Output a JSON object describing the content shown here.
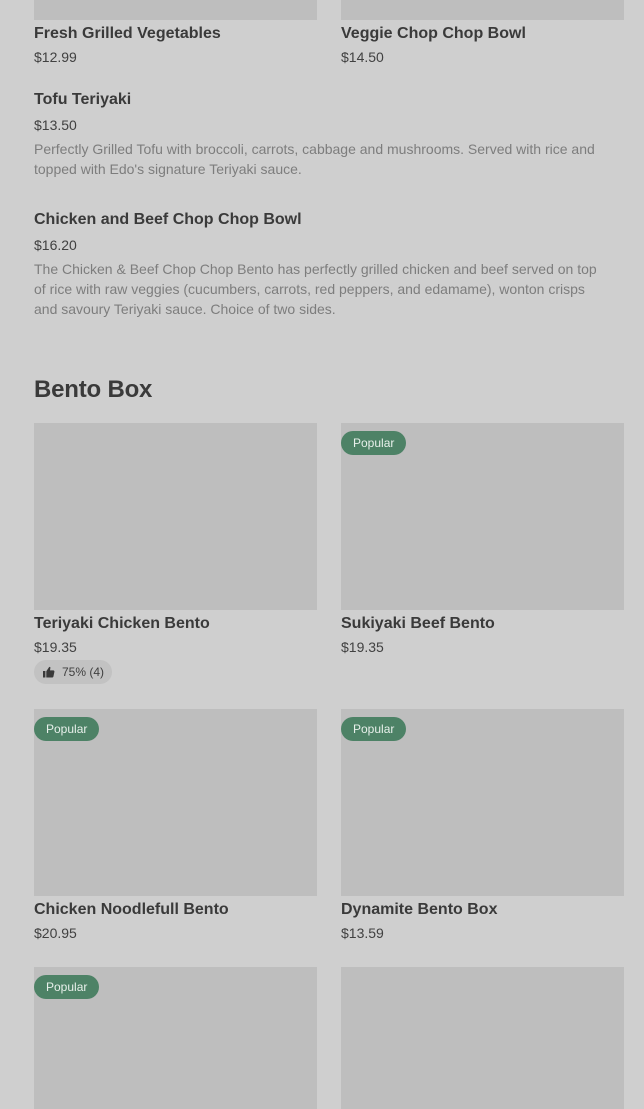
{
  "top_row": [
    {
      "title": "Fresh Grilled Vegetables",
      "price": "$12.99"
    },
    {
      "title": "Veggie Chop Chop Bowl",
      "price": "$14.50"
    }
  ],
  "list_items": [
    {
      "title": "Tofu Teriyaki",
      "price": "$13.50",
      "desc_lines": [
        "Perfectly Grilled Tofu with broccoli, carrots, cabbage and mushrooms. Served with rice and",
        "topped with Edo's signature Teriyaki sauce."
      ]
    },
    {
      "title": "Chicken and Beef Chop Chop Bowl",
      "price": "$16.20",
      "desc_lines": [
        "The Chicken & Beef Chop Chop Bento has perfectly grilled chicken and beef served on top",
        "of rice with raw veggies (cucumbers, carrots, red peppers, and edamame), wonton crisps",
        "and savoury Teriyaki sauce. Choice of two sides."
      ]
    }
  ],
  "section": {
    "title": "Bento Box"
  },
  "cards": [
    {
      "title": "Teriyaki Chicken Bento",
      "price": "$19.35",
      "badge": "",
      "rating": "75% (4)"
    },
    {
      "title": "Sukiyaki Beef Bento",
      "price": "$19.35",
      "badge": "Popular"
    },
    {
      "title": "Chicken Noodlefull Bento",
      "price": "$20.95",
      "badge": "Popular"
    },
    {
      "title": "Dynamite Bento Box",
      "price": "$13.59",
      "badge": "Popular"
    },
    {
      "badge": "Popular"
    }
  ],
  "colors": {
    "background": "#cfcfcf",
    "image_placeholder": "#bebebe",
    "badge": "#4d8266"
  },
  "icons": {
    "rating": "thumbs-up-icon"
  }
}
